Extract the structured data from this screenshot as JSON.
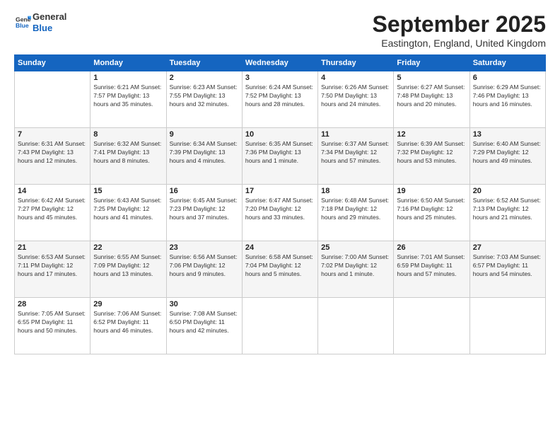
{
  "header": {
    "logo_line1": "General",
    "logo_line2": "Blue",
    "month": "September 2025",
    "location": "Eastington, England, United Kingdom"
  },
  "weekdays": [
    "Sunday",
    "Monday",
    "Tuesday",
    "Wednesday",
    "Thursday",
    "Friday",
    "Saturday"
  ],
  "weeks": [
    [
      {
        "day": "",
        "detail": ""
      },
      {
        "day": "1",
        "detail": "Sunrise: 6:21 AM\nSunset: 7:57 PM\nDaylight: 13 hours\nand 35 minutes."
      },
      {
        "day": "2",
        "detail": "Sunrise: 6:23 AM\nSunset: 7:55 PM\nDaylight: 13 hours\nand 32 minutes."
      },
      {
        "day": "3",
        "detail": "Sunrise: 6:24 AM\nSunset: 7:52 PM\nDaylight: 13 hours\nand 28 minutes."
      },
      {
        "day": "4",
        "detail": "Sunrise: 6:26 AM\nSunset: 7:50 PM\nDaylight: 13 hours\nand 24 minutes."
      },
      {
        "day": "5",
        "detail": "Sunrise: 6:27 AM\nSunset: 7:48 PM\nDaylight: 13 hours\nand 20 minutes."
      },
      {
        "day": "6",
        "detail": "Sunrise: 6:29 AM\nSunset: 7:46 PM\nDaylight: 13 hours\nand 16 minutes."
      }
    ],
    [
      {
        "day": "7",
        "detail": "Sunrise: 6:31 AM\nSunset: 7:43 PM\nDaylight: 13 hours\nand 12 minutes."
      },
      {
        "day": "8",
        "detail": "Sunrise: 6:32 AM\nSunset: 7:41 PM\nDaylight: 13 hours\nand 8 minutes."
      },
      {
        "day": "9",
        "detail": "Sunrise: 6:34 AM\nSunset: 7:39 PM\nDaylight: 13 hours\nand 4 minutes."
      },
      {
        "day": "10",
        "detail": "Sunrise: 6:35 AM\nSunset: 7:36 PM\nDaylight: 13 hours\nand 1 minute."
      },
      {
        "day": "11",
        "detail": "Sunrise: 6:37 AM\nSunset: 7:34 PM\nDaylight: 12 hours\nand 57 minutes."
      },
      {
        "day": "12",
        "detail": "Sunrise: 6:39 AM\nSunset: 7:32 PM\nDaylight: 12 hours\nand 53 minutes."
      },
      {
        "day": "13",
        "detail": "Sunrise: 6:40 AM\nSunset: 7:29 PM\nDaylight: 12 hours\nand 49 minutes."
      }
    ],
    [
      {
        "day": "14",
        "detail": "Sunrise: 6:42 AM\nSunset: 7:27 PM\nDaylight: 12 hours\nand 45 minutes."
      },
      {
        "day": "15",
        "detail": "Sunrise: 6:43 AM\nSunset: 7:25 PM\nDaylight: 12 hours\nand 41 minutes."
      },
      {
        "day": "16",
        "detail": "Sunrise: 6:45 AM\nSunset: 7:23 PM\nDaylight: 12 hours\nand 37 minutes."
      },
      {
        "day": "17",
        "detail": "Sunrise: 6:47 AM\nSunset: 7:20 PM\nDaylight: 12 hours\nand 33 minutes."
      },
      {
        "day": "18",
        "detail": "Sunrise: 6:48 AM\nSunset: 7:18 PM\nDaylight: 12 hours\nand 29 minutes."
      },
      {
        "day": "19",
        "detail": "Sunrise: 6:50 AM\nSunset: 7:16 PM\nDaylight: 12 hours\nand 25 minutes."
      },
      {
        "day": "20",
        "detail": "Sunrise: 6:52 AM\nSunset: 7:13 PM\nDaylight: 12 hours\nand 21 minutes."
      }
    ],
    [
      {
        "day": "21",
        "detail": "Sunrise: 6:53 AM\nSunset: 7:11 PM\nDaylight: 12 hours\nand 17 minutes."
      },
      {
        "day": "22",
        "detail": "Sunrise: 6:55 AM\nSunset: 7:09 PM\nDaylight: 12 hours\nand 13 minutes."
      },
      {
        "day": "23",
        "detail": "Sunrise: 6:56 AM\nSunset: 7:06 PM\nDaylight: 12 hours\nand 9 minutes."
      },
      {
        "day": "24",
        "detail": "Sunrise: 6:58 AM\nSunset: 7:04 PM\nDaylight: 12 hours\nand 5 minutes."
      },
      {
        "day": "25",
        "detail": "Sunrise: 7:00 AM\nSunset: 7:02 PM\nDaylight: 12 hours\nand 1 minute."
      },
      {
        "day": "26",
        "detail": "Sunrise: 7:01 AM\nSunset: 6:59 PM\nDaylight: 11 hours\nand 57 minutes."
      },
      {
        "day": "27",
        "detail": "Sunrise: 7:03 AM\nSunset: 6:57 PM\nDaylight: 11 hours\nand 54 minutes."
      }
    ],
    [
      {
        "day": "28",
        "detail": "Sunrise: 7:05 AM\nSunset: 6:55 PM\nDaylight: 11 hours\nand 50 minutes."
      },
      {
        "day": "29",
        "detail": "Sunrise: 7:06 AM\nSunset: 6:52 PM\nDaylight: 11 hours\nand 46 minutes."
      },
      {
        "day": "30",
        "detail": "Sunrise: 7:08 AM\nSunset: 6:50 PM\nDaylight: 11 hours\nand 42 minutes."
      },
      {
        "day": "",
        "detail": ""
      },
      {
        "day": "",
        "detail": ""
      },
      {
        "day": "",
        "detail": ""
      },
      {
        "day": "",
        "detail": ""
      }
    ]
  ]
}
